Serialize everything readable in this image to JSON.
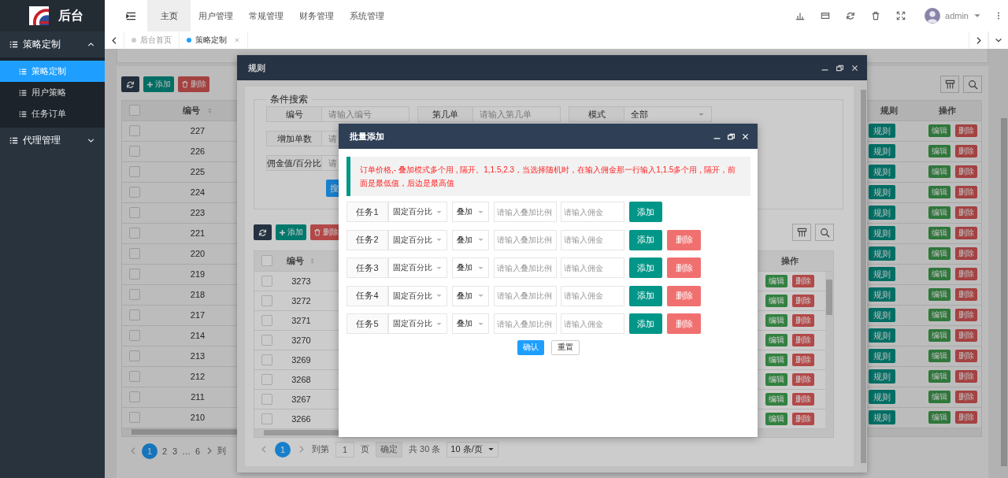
{
  "sidebar": {
    "logo_text": "后台",
    "groups": [
      {
        "label": "策略定制",
        "expanded": true,
        "children": [
          {
            "label": "策略定制",
            "selected": true
          },
          {
            "label": "用户策略",
            "selected": false
          },
          {
            "label": "任务订单",
            "selected": false
          }
        ]
      },
      {
        "label": "代理管理",
        "expanded": false
      }
    ]
  },
  "header": {
    "nav": [
      {
        "label": "主页",
        "selected": true
      },
      {
        "label": "用户管理",
        "selected": false
      },
      {
        "label": "常规管理",
        "selected": false
      },
      {
        "label": "财务管理",
        "selected": false
      },
      {
        "label": "系统管理",
        "selected": false
      }
    ],
    "user": "admin"
  },
  "page_tabs": [
    {
      "label": "后台首页",
      "selected": false,
      "closable": false
    },
    {
      "label": "策略定制",
      "selected": true,
      "closable": true
    }
  ],
  "main": {
    "toolbar": [
      {
        "kind": "refresh"
      },
      {
        "kind": "add",
        "label": "添加"
      },
      {
        "kind": "delete",
        "label": "删除"
      }
    ],
    "table": {
      "all_checked": false,
      "columns": [
        "编号",
        "规则",
        "操作"
      ],
      "rows": [
        {
          "id": "227",
          "checked": false,
          "rule": "规则",
          "edit": "编辑",
          "delete": "删除"
        },
        {
          "id": "226",
          "checked": false,
          "rule": "规则",
          "edit": "编辑",
          "delete": "删除"
        },
        {
          "id": "225",
          "checked": false,
          "rule": "规则",
          "edit": "编辑",
          "delete": "删除"
        },
        {
          "id": "224",
          "checked": false,
          "rule": "规则",
          "edit": "编辑",
          "delete": "删除"
        },
        {
          "id": "223",
          "checked": false,
          "rule": "规则",
          "edit": "编辑",
          "delete": "删除"
        },
        {
          "id": "221",
          "checked": false,
          "rule": "规则",
          "edit": "编辑",
          "delete": "删除"
        },
        {
          "id": "220",
          "checked": false,
          "rule": "规则",
          "edit": "编辑",
          "delete": "删除"
        },
        {
          "id": "219",
          "checked": false,
          "rule": "规则",
          "edit": "编辑",
          "delete": "删除"
        },
        {
          "id": "218",
          "checked": false,
          "rule": "规则",
          "edit": "编辑",
          "delete": "删除"
        },
        {
          "id": "217",
          "checked": false,
          "rule": "规则",
          "edit": "编辑",
          "delete": "删除"
        },
        {
          "id": "214",
          "checked": false,
          "rule": "规则",
          "edit": "编辑",
          "delete": "删除"
        },
        {
          "id": "213",
          "checked": false,
          "rule": "规则",
          "edit": "编辑",
          "delete": "删除"
        },
        {
          "id": "212",
          "checked": false,
          "rule": "规则",
          "edit": "编辑",
          "delete": "删除"
        },
        {
          "id": "211",
          "checked": false,
          "rule": "规则",
          "edit": "编辑",
          "delete": "删除"
        },
        {
          "id": "210",
          "checked": false,
          "rule": "规则",
          "edit": "编辑",
          "delete": "删除"
        }
      ]
    },
    "pagination": {
      "items": [
        {
          "kind": "page",
          "label": "1",
          "selected": true
        },
        {
          "kind": "page",
          "label": "2",
          "selected": false
        },
        {
          "kind": "page",
          "label": "3",
          "selected": false
        },
        {
          "kind": "ellipsis",
          "label": "…"
        },
        {
          "kind": "page",
          "label": "6",
          "selected": false
        }
      ],
      "goto": "到"
    }
  },
  "rule_modal": {
    "title": "规则",
    "search": {
      "legend": "条件搜索",
      "rows": [
        [
          {
            "kind": "input",
            "label": "编号",
            "placeholder": "请输入编号"
          },
          {
            "kind": "input",
            "label": "第几单",
            "placeholder": "请输入第几单"
          },
          {
            "kind": "select",
            "label": "模式",
            "value": "全部"
          }
        ],
        [
          {
            "kind": "input",
            "label": "增加单数",
            "placeholder": "请"
          }
        ],
        [
          {
            "kind": "input",
            "label": "佣金值/百分比",
            "placeholder": "请"
          }
        ]
      ],
      "button": "搜"
    },
    "toolbar": [
      {
        "kind": "refresh"
      },
      {
        "kind": "add",
        "label": "添加"
      },
      {
        "kind": "delete",
        "label": "删除"
      }
    ],
    "table": {
      "all_checked": false,
      "columns": [
        "编号",
        "操作"
      ],
      "rows": [
        {
          "id": "3273",
          "checked": false,
          "edit": "编辑",
          "delete": "删除"
        },
        {
          "id": "3272",
          "checked": false,
          "edit": "编辑",
          "delete": "删除"
        },
        {
          "id": "3271",
          "checked": false,
          "edit": "编辑",
          "delete": "删除"
        },
        {
          "id": "3270",
          "checked": false,
          "edit": "编辑",
          "delete": "删除"
        },
        {
          "id": "3269",
          "checked": false,
          "edit": "编辑",
          "delete": "删除"
        },
        {
          "id": "3268",
          "checked": false,
          "edit": "编辑",
          "delete": "删除"
        },
        {
          "id": "3267",
          "checked": false,
          "edit": "编辑",
          "delete": "删除"
        },
        {
          "id": "3266",
          "checked": false,
          "edit": "编辑",
          "delete": "删除"
        }
      ]
    },
    "pagination": {
      "current": "1",
      "goto": "到第",
      "page_input": "1",
      "page_unit": "页",
      "confirm": "确定",
      "total": "共 30 条",
      "page_size": "10 条/页"
    }
  },
  "batch_modal": {
    "title": "批量添加",
    "notice": "订单价格,- 叠加模式多个用 , 隔开。1,1.5,2.3，当选择随机时，在输入佣金那一行输入1,1.5多个用 , 隔开，前面是最低值，后边是最高值",
    "tasks": [
      {
        "label": "任务1",
        "type": "固定百分比",
        "mode": "叠加",
        "ratio_placeholder": "请输入叠加比例",
        "commission_placeholder": "请输入佣金",
        "add": "添加"
      },
      {
        "label": "任务2",
        "type": "固定百分比",
        "mode": "叠加",
        "ratio_placeholder": "请输入叠加比例",
        "commission_placeholder": "请输入佣金",
        "add": "添加",
        "delete": "删除"
      },
      {
        "label": "任务3",
        "type": "固定百分比",
        "mode": "叠加",
        "ratio_placeholder": "请输入叠加比例",
        "commission_placeholder": "请输入佣金",
        "add": "添加",
        "delete": "删除"
      },
      {
        "label": "任务4",
        "type": "固定百分比",
        "mode": "叠加",
        "ratio_placeholder": "请输入叠加比例",
        "commission_placeholder": "请输入佣金",
        "add": "添加",
        "delete": "删除"
      },
      {
        "label": "任务5",
        "type": "固定百分比",
        "mode": "叠加",
        "ratio_placeholder": "请输入叠加比例",
        "commission_placeholder": "请输入佣金",
        "add": "添加",
        "delete": "删除"
      }
    ],
    "buttons": [
      {
        "kind": "primary",
        "label": "确认"
      },
      {
        "kind": "default",
        "label": "重置"
      }
    ]
  }
}
